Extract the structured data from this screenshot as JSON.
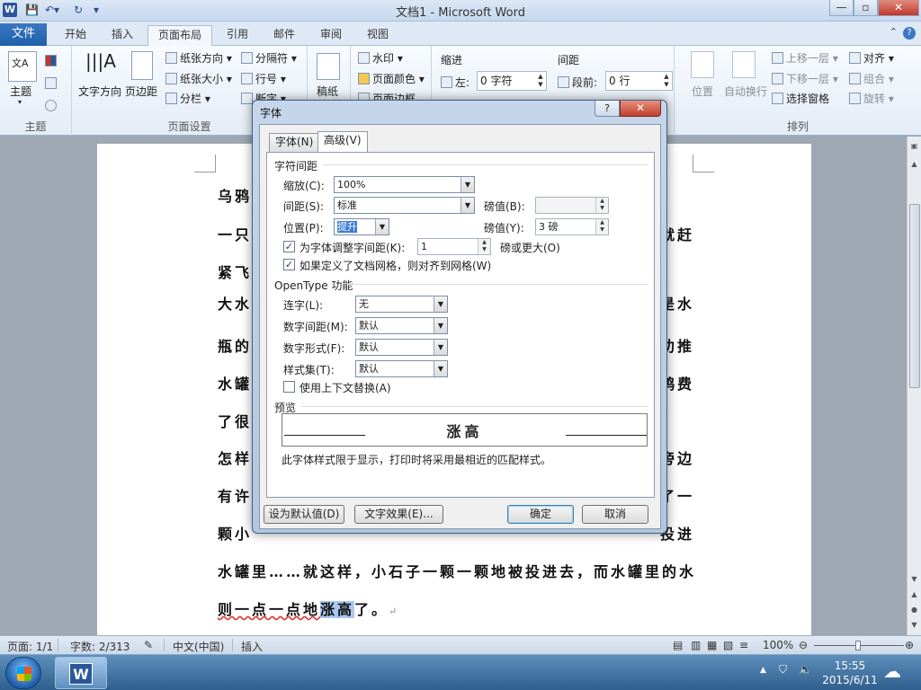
{
  "window": {
    "title": "文档1 - Microsoft Word",
    "app_icon": "W",
    "qat": [
      "save",
      "undo",
      "redo",
      "customize"
    ],
    "controls": {
      "minimize": "—",
      "maximize": "▫",
      "close": "✕"
    }
  },
  "ribbon_tabs": {
    "file": "文件",
    "tabs": [
      "开始",
      "插入",
      "页面布局",
      "引用",
      "邮件",
      "审阅",
      "视图"
    ],
    "active_index": 2
  },
  "ribbon": {
    "theme_group": {
      "label": "主题",
      "theme_btn": "主题"
    },
    "page_setup_group": {
      "label": "页面设置",
      "text_direction": "文字方向",
      "margins": "页边距",
      "orientation": "纸张方向",
      "size": "纸张大小",
      "columns": "分栏",
      "breaks": "分隔符",
      "line_numbers": "行号",
      "hyphenation": "断字"
    },
    "paper": {
      "label": "稿纸"
    },
    "page_background": {
      "watermark": "水印",
      "page_color": "页面颜色",
      "page_borders": "页面边框"
    },
    "paragraph": {
      "indent_label": "缩进",
      "indent_left_label": "左:",
      "indent_left_value": "0 字符",
      "spacing_label": "间距",
      "spacing_before_label": "段前:",
      "spacing_before_value": "0 行"
    },
    "arrange": {
      "label": "排列",
      "position": "位置",
      "wrap_text": "自动换行",
      "bring_forward": "上移一层",
      "send_backward": "下移一层",
      "selection_pane": "选择窗格",
      "align": "对齐",
      "group": "组合",
      "rotate": "旋转"
    }
  },
  "document": {
    "lines": [
      "乌鸦",
      "一只",
      "紧飞",
      "大水",
      "瓶的",
      "水罐",
      "了很",
      "怎样",
      "有许",
      "颗小",
      "水罐里……就这样，小石子一颗一颗地被投进去，而水罐里的水"
    ],
    "right_fragments": [
      "就赶",
      "是水",
      "劝推",
      "鸦费",
      "旁边",
      "了一",
      "投进"
    ],
    "last_line": {
      "before": "则一点一点地",
      "highlight": "涨高",
      "after": "了。",
      "mark": "↵"
    }
  },
  "dialog": {
    "title": "字体",
    "help": "?",
    "close": "✕",
    "tabs": [
      "字体(N)",
      "高级(V)"
    ],
    "active_tab": 1,
    "char_spacing": {
      "section": "字符间距",
      "scale_label": "缩放(C):",
      "scale_value": "100%",
      "spacing_label": "间距(S):",
      "spacing_value": "标准",
      "spacing_by_label": "磅值(B):",
      "spacing_by_value": "",
      "position_label": "位置(P):",
      "position_value": "提升",
      "position_by_label": "磅值(Y):",
      "position_by_value": "3 磅",
      "kerning_label": "为字体调整字间距(K):",
      "kerning_value": "1",
      "kerning_suffix": "磅或更大(O)",
      "kerning_checked": true,
      "grid_label": "如果定义了文档网格，则对齐到网格(W)",
      "grid_checked": true
    },
    "opentype": {
      "section": "OpenType 功能",
      "ligatures_label": "连字(L):",
      "ligatures_value": "无",
      "num_spacing_label": "数字间距(M):",
      "num_spacing_value": "默认",
      "num_forms_label": "数字形式(F):",
      "num_forms_value": "默认",
      "stylistic_label": "样式集(T):",
      "stylistic_value": "默认",
      "contextual_label": "使用上下文替换(A)",
      "contextual_checked": false
    },
    "preview": {
      "section": "预览",
      "text": "涨高",
      "note": "此字体样式限于显示，打印时将采用最相近的匹配样式。"
    },
    "buttons": {
      "set_default": "设为默认值(D)",
      "text_effects": "文字效果(E)...",
      "ok": "确定",
      "cancel": "取消"
    }
  },
  "statusbar": {
    "page": "页面: 1/1",
    "words": "字数: 2/313",
    "language": "中文(中国)",
    "mode": "插入",
    "zoom": "100%"
  },
  "taskbar": {
    "time": "15:55",
    "date": "2015/6/11"
  },
  "colors": {
    "accent": "#2b579a",
    "file_tab": "#2a6bbd",
    "selection": "#a8c8ee"
  }
}
